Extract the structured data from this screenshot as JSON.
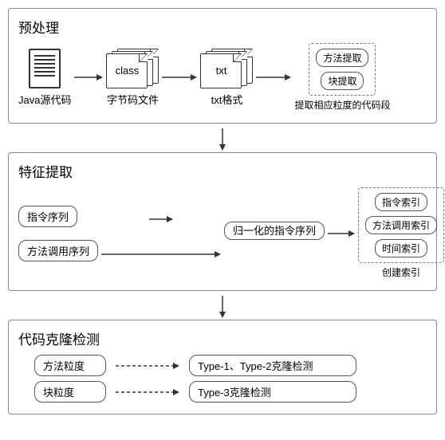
{
  "stage1": {
    "title": "预处理",
    "src_caption": "Java源代码",
    "class_label": "class",
    "bytecode_caption": "字节码文件",
    "txt_label": "txt",
    "txt_caption": "txt格式",
    "extract": {
      "method": "方法提取",
      "block": "块提取",
      "caption": "提取相应粒度的代码段"
    }
  },
  "stage2": {
    "title": "特征提取",
    "instr_seq": "指令序列",
    "call_seq": "方法调用序列",
    "norm_seq": "归一化的指令序列",
    "index": {
      "instr": "指令索引",
      "call": "方法调用索引",
      "time": "时间索引",
      "caption": "创建索引"
    }
  },
  "stage3": {
    "title": "代码克隆检测",
    "method_gran": "方法粒度",
    "block_gran": "块粒度",
    "type12": "Type-1、Type-2克隆检测",
    "type3": "Type-3克隆检测"
  },
  "chart_data": {
    "type": "flowchart",
    "stages": [
      {
        "name": "预处理",
        "nodes": [
          "Java源代码",
          "字节码文件(class)",
          "txt格式",
          "提取相应粒度的代码段(方法提取/块提取)"
        ],
        "edges": [
          [
            "Java源代码",
            "字节码文件(class)"
          ],
          [
            "字节码文件(class)",
            "txt格式"
          ],
          [
            "txt格式",
            "提取相应粒度的代码段"
          ]
        ]
      },
      {
        "name": "特征提取",
        "nodes": [
          "指令序列",
          "方法调用序列",
          "归一化的指令序列",
          "指令索引",
          "方法调用索引",
          "时间索引"
        ],
        "edges": [
          [
            "指令序列",
            "归一化的指令序列"
          ],
          [
            "归一化的指令序列",
            "指令索引"
          ],
          [
            "归一化的指令序列",
            "方法调用索引"
          ],
          [
            "归一化的指令序列",
            "时间索引"
          ],
          [
            "方法调用序列",
            "方法调用索引"
          ],
          [
            "方法调用序列",
            "时间索引"
          ]
        ],
        "group": {
          "label": "创建索引",
          "members": [
            "指令索引",
            "方法调用索引",
            "时间索引"
          ]
        }
      },
      {
        "name": "代码克隆检测",
        "nodes": [
          "方法粒度",
          "块粒度",
          "Type-1、Type-2克隆检测",
          "Type-3克隆检测"
        ],
        "edges": [
          [
            "方法粒度",
            "Type-1、Type-2克隆检测"
          ],
          [
            "块粒度",
            "Type-3克隆检测"
          ]
        ],
        "edge_style": "dashed"
      }
    ],
    "stage_edges": [
      [
        "预处理",
        "特征提取"
      ],
      [
        "特征提取",
        "代码克隆检测"
      ]
    ]
  }
}
